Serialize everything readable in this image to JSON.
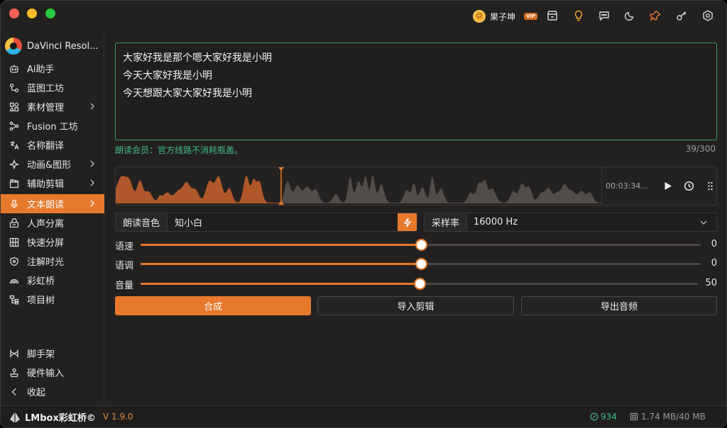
{
  "app": {
    "name": "DaVinci Resol...",
    "user": "果子坤",
    "vip_badge": "VIP"
  },
  "sidebar": {
    "items": [
      {
        "label": "Ai助手",
        "icon": "robot-icon",
        "chevron": false
      },
      {
        "label": "蓝图工坊",
        "icon": "blueprint-icon",
        "chevron": false
      },
      {
        "label": "素材管理",
        "icon": "assets-icon",
        "chevron": true
      },
      {
        "label": "Fusion 工坊",
        "icon": "fusion-icon",
        "chevron": false
      },
      {
        "label": "名称翻译",
        "icon": "translate-icon",
        "chevron": false
      },
      {
        "label": "动画&图形",
        "icon": "sparkle-icon",
        "chevron": true
      },
      {
        "label": "辅助剪辑",
        "icon": "clapper-icon",
        "chevron": true
      },
      {
        "label": "文本朗读",
        "icon": "microphone-icon",
        "chevron": true,
        "active": true
      },
      {
        "label": "人声分离",
        "icon": "split-icon",
        "chevron": false
      },
      {
        "label": "快速分屏",
        "icon": "grid-icon",
        "chevron": false
      },
      {
        "label": "注解时光",
        "icon": "shield-icon",
        "chevron": false
      },
      {
        "label": "彩虹桥",
        "icon": "rainbow-icon",
        "chevron": false
      },
      {
        "label": "项目树",
        "icon": "tree-icon",
        "chevron": false
      }
    ],
    "bottom_items": [
      {
        "label": "脚手架",
        "icon": "scaffold-icon"
      },
      {
        "label": "硬件输入",
        "icon": "joystick-icon"
      },
      {
        "label": "收起",
        "icon": "chevron-left-icon"
      }
    ]
  },
  "editor": {
    "lines": [
      "大家好我是那个嗯大家好我是小明",
      "今天大家好我是小明",
      "今天想跟大家大家好我是小明"
    ],
    "member_note": "朗读会员：官方线路不消耗瓶盖。",
    "counter": "39/300"
  },
  "player": {
    "time": "00:03:34...",
    "progress": 0.275
  },
  "voice": {
    "label": "朗读音色",
    "value": "知小白"
  },
  "sample_rate": {
    "label": "采样率",
    "value": "16000 Hz"
  },
  "sliders": [
    {
      "label": "语速",
      "value": "0",
      "fraction": 0.5
    },
    {
      "label": "语调",
      "value": "0",
      "fraction": 0.5
    },
    {
      "label": "音量",
      "value": "50",
      "fraction": 0.5
    }
  ],
  "actions": {
    "synthesize": "合成",
    "import_edit": "导入剪辑",
    "export_audio": "导出音频"
  },
  "status": {
    "brand": "LMbox彩虹桥©",
    "version": "V 1.9.0",
    "count": "934",
    "memory": "1.74 MB/40 MB"
  },
  "colors": {
    "accent": "#e6792b",
    "success": "#3fb98a",
    "background": "#232120"
  }
}
